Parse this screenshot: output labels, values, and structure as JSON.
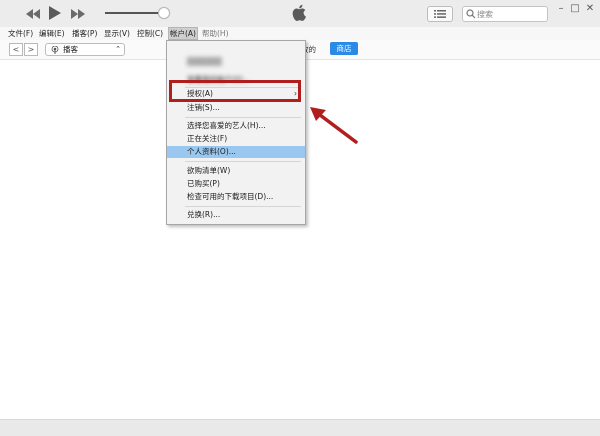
{
  "player": {
    "rewind": "◀◀",
    "play": "▶",
    "forward": "▶▶"
  },
  "search": {
    "placeholder": "搜索",
    "value": ""
  },
  "menubar": {
    "file": "文件(F)",
    "edit": "编辑(E)",
    "podcast": "播客(P)",
    "view": "显示(V)",
    "controls": "控制(C)",
    "account": "帐户(A)",
    "help": "帮助(H)"
  },
  "nav": {
    "back": "<",
    "forward": ">",
    "media": "播客",
    "partial": "放的",
    "store": "商店"
  },
  "dropdown": {
    "blurred_top": "██████",
    "view_account": "查看我的帐户(V)...",
    "authorize": "授权(A)",
    "sign_out": "注销(S)...",
    "favorite_artists": "选择您喜爱的艺人(H)...",
    "following": "正在关注(F)",
    "profile": "个人资料(O)...",
    "wishlist": "欲购清单(W)",
    "purchased": "已购买(P)",
    "check_downloads": "检查可用的下载项目(D)...",
    "redeem": "兑换(R)..."
  },
  "colors": {
    "annotation": "#b11e1e",
    "highlight": "#99c7f0",
    "store_blue": "#2a8ae6"
  }
}
